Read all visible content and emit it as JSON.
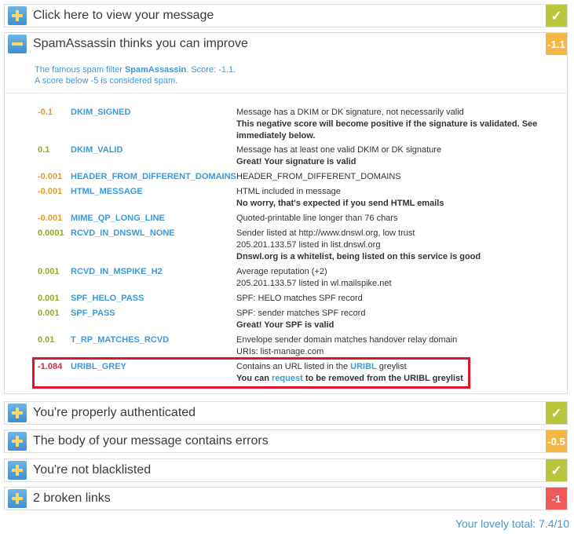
{
  "sections": {
    "view_message": {
      "title": "Click here to view your message",
      "status": "check"
    },
    "spamassassin": {
      "title": "SpamAssassin thinks you can improve",
      "score": "-1.1"
    },
    "authenticated": {
      "title": "You're properly authenticated",
      "status": "check"
    },
    "body_errors": {
      "title": "The body of your message contains errors",
      "score": "-0.5"
    },
    "blacklisted": {
      "title": "You're not blacklisted",
      "status": "check"
    },
    "broken_links": {
      "title": "2 broken links",
      "score": "-1"
    }
  },
  "spam_intro": {
    "line1_prefix": "The famous spam filter ",
    "line1_brand": "SpamAssassin",
    "line1_suffix": ". Score: -1.1.",
    "line2": "A score below -5 is considered spam."
  },
  "tests": [
    {
      "score": "-0.1",
      "name": "DKIM_SIGNED",
      "desc": [
        "Message has a DKIM or DK signature, not necessarily valid"
      ],
      "note": "This negative score will become positive if the signature is validated. See immediately below."
    },
    {
      "score": "0.1",
      "name": "DKIM_VALID",
      "desc": [
        "Message has at least one valid DKIM or DK signature"
      ],
      "note": "Great! Your signature is valid"
    },
    {
      "score": "-0.001",
      "name": "HEADER_FROM_DIFFERENT_DOMAINS",
      "desc": [
        "HEADER_FROM_DIFFERENT_DOMAINS"
      ],
      "note": ""
    },
    {
      "score": "-0.001",
      "name": "HTML_MESSAGE",
      "desc": [
        "HTML included in message"
      ],
      "note": "No worry, that's expected if you send HTML emails"
    },
    {
      "score": "-0.001",
      "name": "MIME_QP_LONG_LINE",
      "desc": [
        "Quoted-printable line longer than 76 chars"
      ],
      "note": ""
    },
    {
      "score": "0.0001",
      "name": "RCVD_IN_DNSWL_NONE",
      "desc": [
        "Sender listed at http://www.dnswl.org, low trust",
        "205.201.133.57 listed in list.dnswl.org"
      ],
      "note": "Dnswl.org is a whitelist, being listed on this service is good"
    },
    {
      "score": "0.001",
      "name": "RCVD_IN_MSPIKE_H2",
      "desc": [
        "Average reputation (+2)",
        "205.201.133.57 listed in wl.mailspike.net"
      ],
      "note": ""
    },
    {
      "score": "0.001",
      "name": "SPF_HELO_PASS",
      "desc": [
        "SPF: HELO matches SPF record"
      ],
      "note": ""
    },
    {
      "score": "0.001",
      "name": "SPF_PASS",
      "desc": [
        "SPF: sender matches SPF record"
      ],
      "note": "Great! Your SPF is valid"
    },
    {
      "score": "0.01",
      "name": "T_RP_MATCHES_RCVD",
      "desc": [
        "Envelope sender domain matches handover relay domain",
        "URIs: list-manage.com"
      ],
      "note": ""
    }
  ],
  "uribl": {
    "score": "-1.084",
    "name": "URIBL_GREY",
    "desc_prefix": "Contains an URL listed in the ",
    "desc_link": "URIBL",
    "desc_suffix": " greylist",
    "note_prefix": "You can ",
    "note_link": "request",
    "note_suffix": " to be removed from the URIBL greylist"
  },
  "total": "Your lovely total: 7.4/10",
  "colors": {
    "accent_blue": "#3a9ad9",
    "badge_green": "#b9c63b",
    "badge_orange": "#f5b744",
    "badge_red": "#ee5a5a",
    "highlight_red": "#e0142b"
  }
}
